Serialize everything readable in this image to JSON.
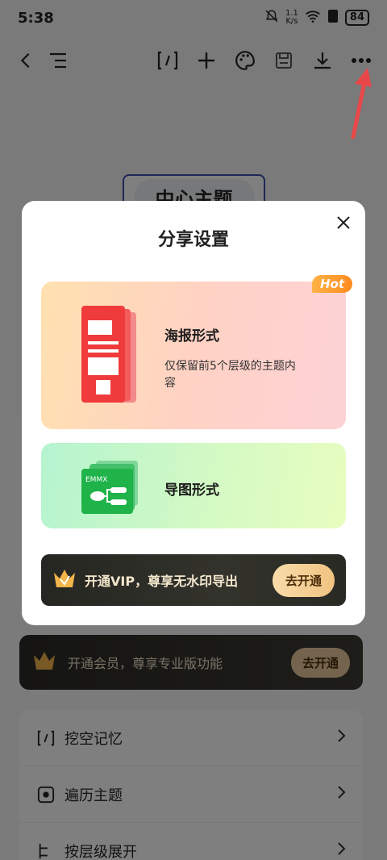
{
  "status": {
    "time": "5:38",
    "speed_value": "1.1",
    "speed_unit": "K/s",
    "battery": "84"
  },
  "background": {
    "node_text": "中心主题",
    "vip_banner": {
      "text": "开通会员，尊享专业版功能",
      "button": "去开通"
    },
    "menu": [
      {
        "label": "挖空记忆",
        "icon": "bracket-icon"
      },
      {
        "label": "遍历主题",
        "icon": "focus-icon"
      },
      {
        "label": "按层级展开",
        "icon": "tree-icon"
      }
    ]
  },
  "dialog": {
    "title": "分享设置",
    "options": [
      {
        "title": "海报形式",
        "desc": "仅保留前5个层级的主题内容",
        "badge": "Hot"
      },
      {
        "title": "导图形式",
        "thumb_label": "EMMX"
      }
    ],
    "vip": {
      "text": "开通VIP，尊享无水印导出",
      "button": "去开通"
    }
  },
  "colors": {
    "accent_red": "#ef3b3b",
    "accent_green": "#1fb34a",
    "gold": "#f0c381"
  }
}
